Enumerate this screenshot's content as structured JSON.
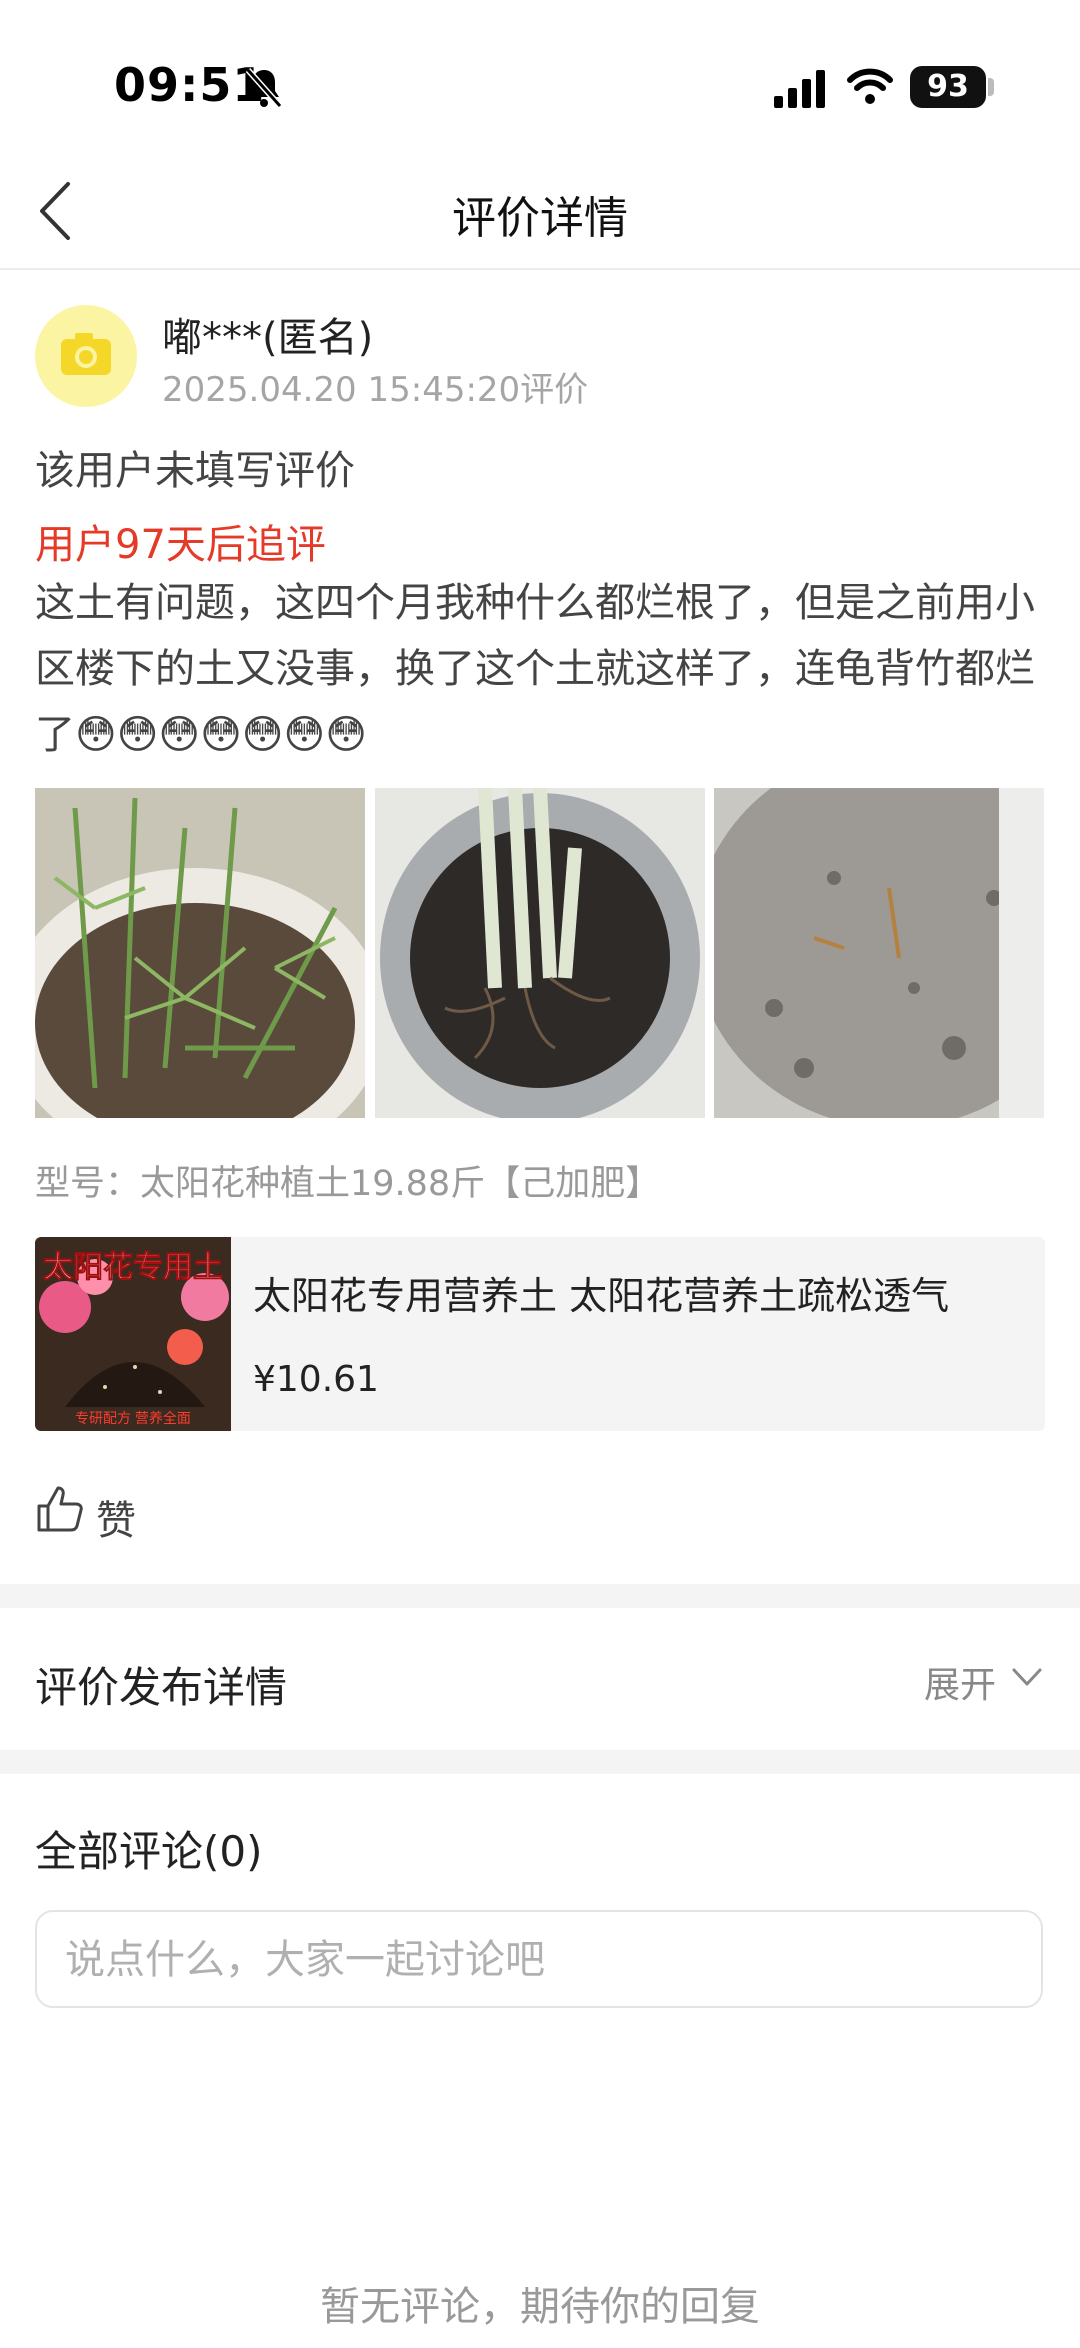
{
  "status_bar": {
    "time": "09:51",
    "battery": "93",
    "icons": [
      "bell-slash-icon",
      "signal-icon",
      "wifi-icon",
      "battery-icon"
    ]
  },
  "nav": {
    "back_icon": "chevron-left-icon",
    "title": "评价详情"
  },
  "review": {
    "avatar_icon": "camera-icon",
    "username": "嘟***(匿名)",
    "time": "2025.04.20 15:45:20评价",
    "text": "该用户未填写评价",
    "followup_label": "用户97天后追评",
    "followup_text": "这土有问题，这四个月我种什么都烂根了，但是之前用小区楼下的土又没事，换了这个土就这样了，连龟背竹都烂了😳😳😳😳😳😳😳",
    "photos": [
      "plant-seedlings-photo",
      "rotted-roots-photo",
      "dry-soil-photo"
    ],
    "model": "型号：太阳花种植土19.88斤【己加肥】"
  },
  "product": {
    "image_text": "太阳花专用土",
    "image_subtext": "专研配方 营养全面",
    "title": "太阳花专用营养土 太阳花营养土疏松透气",
    "price": "¥10.61"
  },
  "actions": {
    "like_icon": "thumbs-up-icon",
    "like_label": "赞"
  },
  "publish_detail": {
    "label": "评价发布详情",
    "expand": "展开",
    "expand_icon": "chevron-down-icon"
  },
  "comments": {
    "title": "全部评论(0)",
    "input_placeholder": "说点什么，大家一起讨论吧",
    "empty_text": "暂无评论，期待你的回复"
  },
  "colors": {
    "accent_red": "#e53a28",
    "avatar_bg": "#fbf4a3",
    "avatar_icon": "#f5d72a"
  }
}
